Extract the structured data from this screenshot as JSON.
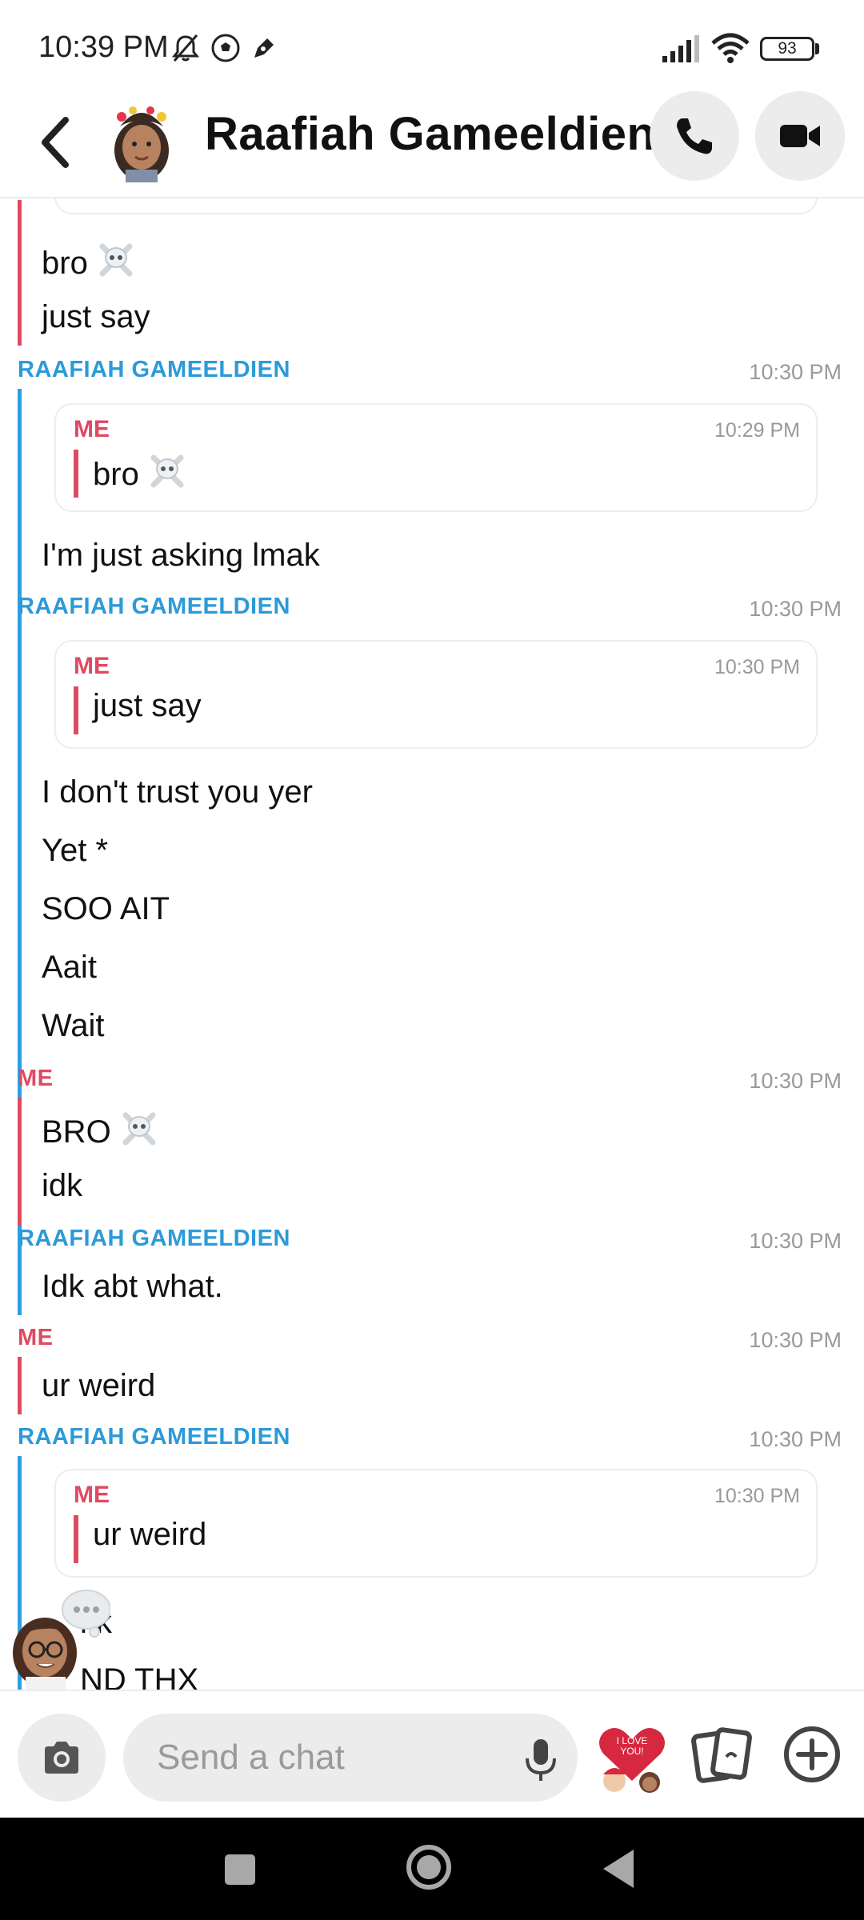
{
  "status_bar": {
    "time": "10:39 PM",
    "battery": "93",
    "icons": [
      "mute-bell-icon",
      "soccer-ball-icon",
      "ink-pen-icon",
      "signal-icon",
      "wifi-icon",
      "battery-icon"
    ]
  },
  "header": {
    "contact_name": "Raafiah Gameeldien",
    "icons": [
      "back-chevron-icon",
      "avatar",
      "phone-icon",
      "video-camera-icon"
    ]
  },
  "chat": {
    "top_group": {
      "messages": [
        "bro",
        "just say"
      ]
    },
    "group2": {
      "sender": "RAAFIAH GAMEELDIEN",
      "time": "10:30 PM",
      "quote": {
        "sender": "ME",
        "time": "10:29 PM",
        "text": "bro"
      },
      "messages": [
        "I'm just asking lmak"
      ]
    },
    "group3": {
      "sender": "RAAFIAH GAMEELDIEN",
      "time": "10:30 PM",
      "quote": {
        "sender": "ME",
        "time": "10:30 PM",
        "text": "just say"
      },
      "messages": [
        "I don't trust you yer",
        "Yet *",
        "SOO AIT",
        "Aait",
        "Wait"
      ]
    },
    "group4": {
      "sender": "ME",
      "time": "10:30 PM",
      "messages": [
        "BRO",
        "idk"
      ]
    },
    "group5": {
      "sender": "RAAFIAH GAMEELDIEN",
      "time": "10:30 PM",
      "messages": [
        "Idk abt what."
      ]
    },
    "group6": {
      "sender": "ME",
      "time": "10:30 PM",
      "messages": [
        "ur weird"
      ]
    },
    "group7": {
      "sender": "RAAFIAH GAMEELDIEN",
      "time": "10:30 PM",
      "quote": {
        "sender": "ME",
        "time": "10:30 PM",
        "text": "ur weird"
      },
      "messages": [
        "kk",
        "ND THX"
      ]
    }
  },
  "composer": {
    "placeholder": "Send a chat",
    "sticker_text": "I LOVE YOU!"
  },
  "colors": {
    "me": "#df4a62",
    "them": "#2c9ad9",
    "nav_bar": "#000000"
  }
}
